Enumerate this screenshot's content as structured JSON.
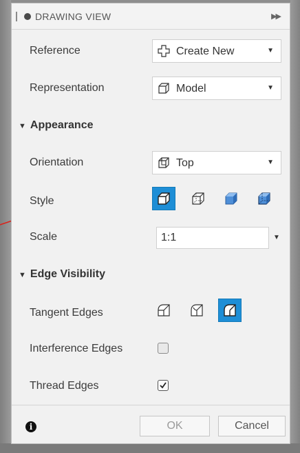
{
  "dialog": {
    "title": "DRAWING VIEW"
  },
  "rows": {
    "reference": {
      "label": "Reference",
      "value": "Create New",
      "icon": "create-new-icon"
    },
    "representation": {
      "label": "Representation",
      "value": "Model",
      "icon": "model-icon"
    }
  },
  "appearance": {
    "heading": "Appearance",
    "orientation": {
      "label": "Orientation",
      "value": "Top",
      "icon": "top-view-icon"
    },
    "style": {
      "label": "Style",
      "selected": 0,
      "options": [
        "visible-edges",
        "visible-and-hidden-edges",
        "shaded",
        "shaded-with-hidden-edges"
      ]
    },
    "scale": {
      "label": "Scale",
      "value": "1:1"
    }
  },
  "edge_visibility": {
    "heading": "Edge Visibility",
    "tangent": {
      "label": "Tangent Edges",
      "selected": 2
    },
    "interference": {
      "label": "Interference Edges",
      "checked": false
    },
    "thread": {
      "label": "Thread Edges",
      "checked": true
    }
  },
  "footer": {
    "ok_label": "OK",
    "cancel_label": "Cancel"
  },
  "colors": {
    "accent": "#1e8ed6",
    "panel_bg": "#f1f1f1",
    "annotation_arrow": "#d9241c"
  }
}
